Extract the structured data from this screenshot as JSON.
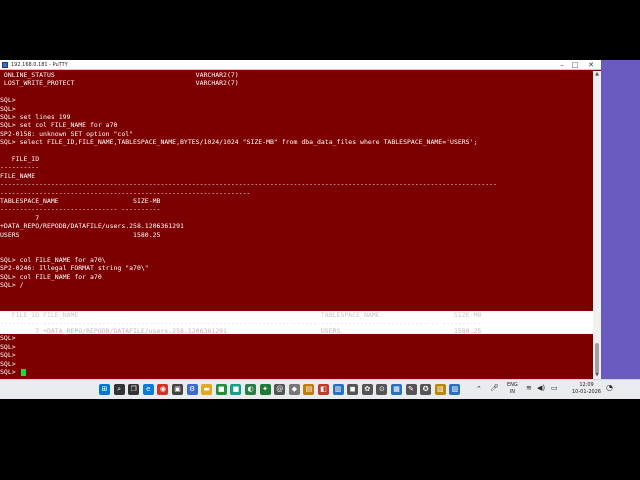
{
  "window": {
    "title": "192.168.0.181 - PuTTY",
    "minimize": "–",
    "maximize": "□",
    "close": "✕"
  },
  "terminal": {
    "lines": [
      " ONLINE_STATUS                                    VARCHAR2(7)",
      " LOST_WRITE_PROTECT                               VARCHAR2(7)",
      "",
      "SQL>",
      "SQL>",
      "SQL> set lines 199",
      "SQL> set col FILE_NAME for a70",
      "SP2-0158: unknown SET option \"col\"",
      "SQL> select FILE_ID,FILE_NAME,TABLESPACE_NAME,BYTES/1024/1024 \"SIZE-MB\" from dba_data_files where TABLESPACE_NAME='USERS';",
      "",
      "   FILE_ID",
      "----------",
      "FILE_NAME",
      "-------------------------------------------------------------------------------------------------------------------------------",
      "----------------------------------------------------------------",
      "TABLESPACE_NAME                   SIZE-MB",
      "------------------------------ ----------",
      "         7",
      "+DATA_REPO/REPODB/DATAFILE/users.258.1206361291",
      "USERS                             1580.25",
      "",
      "",
      "SQL> col FILE_NAME for a70\\",
      "SP2-0246: Illegal FORMAT string \"a70\\\"",
      "SQL> col FILE_NAME for a70",
      "SQL> /"
    ],
    "highlight": {
      "header": "   FILE_ID FILE_NAME                                                              TABLESPACE_NAME                   SIZE-MB",
      "dashes": "---------- ---------------------------------------------------------------------- ------------------------------ ----------",
      "row": "         7 +DATA_REPO/REPODB/DATAFILE/users.258.1206361291                        USERS                             1580.25"
    },
    "trailing": [
      "SQL>",
      "SQL>",
      "SQL>",
      "SQL>",
      "SQL> "
    ]
  },
  "taskbar": {
    "icons": [
      {
        "name": "start-icon",
        "glyph": "⊞",
        "color": "#0078d4"
      },
      {
        "name": "search-icon",
        "glyph": "⌕",
        "color": "#333333"
      },
      {
        "name": "task-view-icon",
        "glyph": "❐",
        "color": "#333333"
      },
      {
        "name": "edge-icon",
        "glyph": "e",
        "color": "#0a7bd6"
      },
      {
        "name": "chrome-icon",
        "glyph": "◉",
        "color": "#d93025"
      },
      {
        "name": "terminal-icon",
        "glyph": "▣",
        "color": "#444444"
      },
      {
        "name": "settings-icon",
        "glyph": "⚙",
        "color": "#3a6ccf"
      },
      {
        "name": "explorer-icon",
        "glyph": "▬",
        "color": "#e5a823"
      },
      {
        "name": "store-icon",
        "glyph": "■",
        "color": "#1f8f3a"
      },
      {
        "name": "app-icon-1",
        "glyph": "■",
        "color": "#16a085"
      },
      {
        "name": "app-icon-2",
        "glyph": "◐",
        "color": "#2d7d46"
      },
      {
        "name": "app-icon-3",
        "glyph": "✦",
        "color": "#1e7b34"
      },
      {
        "name": "app-icon-4",
        "glyph": "@",
        "color": "#555555"
      },
      {
        "name": "app-icon-5",
        "glyph": "◆",
        "color": "#777777"
      },
      {
        "name": "putty-icon",
        "glyph": "▤",
        "color": "#c27c0e"
      },
      {
        "name": "app-icon-6",
        "glyph": "◧",
        "color": "#c0392b"
      },
      {
        "name": "app-icon-7",
        "glyph": "▥",
        "color": "#2c6fbb"
      },
      {
        "name": "app-icon-8",
        "glyph": "◼",
        "color": "#555555"
      },
      {
        "name": "app-icon-9",
        "glyph": "✿",
        "color": "#555555"
      },
      {
        "name": "app-icon-10",
        "glyph": "⊙",
        "color": "#555555"
      },
      {
        "name": "app-icon-11",
        "glyph": "▦",
        "color": "#2c6fbb"
      },
      {
        "name": "app-icon-12",
        "glyph": "✎",
        "color": "#555555"
      },
      {
        "name": "app-icon-13",
        "glyph": "✪",
        "color": "#555555"
      },
      {
        "name": "app-icon-14",
        "glyph": "▧",
        "color": "#b8860b"
      },
      {
        "name": "app-icon-15",
        "glyph": "▨",
        "color": "#2c6fbb"
      }
    ],
    "tray": {
      "lang_line1": "ENG",
      "lang_line2": "IN",
      "time": "12:09",
      "date": "10-01-2026"
    }
  },
  "colors": {
    "terminal_bg": "#7d0000",
    "terminal_fg": "#ffffff",
    "cursor": "#1fdc2a",
    "desktop": "#6a5bc1"
  }
}
